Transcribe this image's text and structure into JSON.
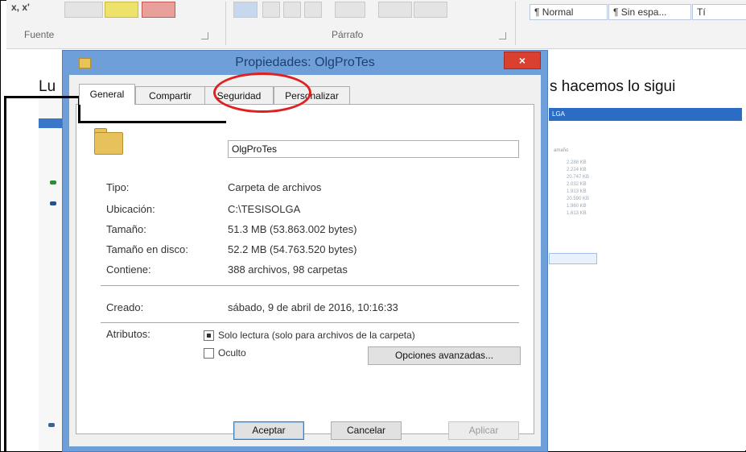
{
  "ribbon": {
    "font_glyphs": "x, x'",
    "font_group_label": "Fuente",
    "paragraph_group_label": "Párrafo",
    "styles": [
      "¶ Normal",
      "¶ Sin espa...",
      "Tí"
    ]
  },
  "document": {
    "heading_left": "Lu",
    "heading_right": "s hacemos lo sigui"
  },
  "explorer_panel": {
    "header": "LGA",
    "column_label": "amaño",
    "sizes": [
      "2.288 KB",
      "2.224 KB",
      "20.747 KB",
      "2.032 KB",
      "1.913 KB",
      "20.590 KB",
      "1.960 KB",
      "1.613 KB"
    ]
  },
  "dialog": {
    "title": "Propiedades: OlgProTes",
    "close_glyph": "×",
    "tabs": [
      {
        "label": "General",
        "active": true
      },
      {
        "label": "Compartir",
        "active": false
      },
      {
        "label": "Seguridad",
        "active": false
      },
      {
        "label": "Personalizar",
        "active": false
      }
    ],
    "name_value": "OlgProTes",
    "properties": [
      {
        "label": "Tipo:",
        "value": "Carpeta de archivos"
      },
      {
        "label": "Ubicación:",
        "value": "C:\\TESISOLGA"
      },
      {
        "label": "Tamaño:",
        "value": "51.3 MB (53.863.002 bytes)"
      },
      {
        "label": "Tamaño en disco:",
        "value": "52.2 MB (54.763.520 bytes)"
      },
      {
        "label": "Contiene:",
        "value": "388 archivos, 98 carpetas"
      }
    ],
    "created": {
      "label": "Creado:",
      "value": "sábado, 9 de abril de 2016, 10:16:33"
    },
    "attributes": {
      "label": "Atributos:",
      "readonly_label": "Solo lectura (solo para archivos de la carpeta)",
      "readonly_state": "indeterminate",
      "hidden_label": "Oculto",
      "hidden_checked": false,
      "advanced_button": "Opciones avanzadas..."
    },
    "buttons": {
      "ok": "Aceptar",
      "cancel": "Cancelar",
      "apply": "Aplicar"
    }
  },
  "annotation": {
    "highlight_color": "#e02020",
    "line_color": "#000000"
  }
}
